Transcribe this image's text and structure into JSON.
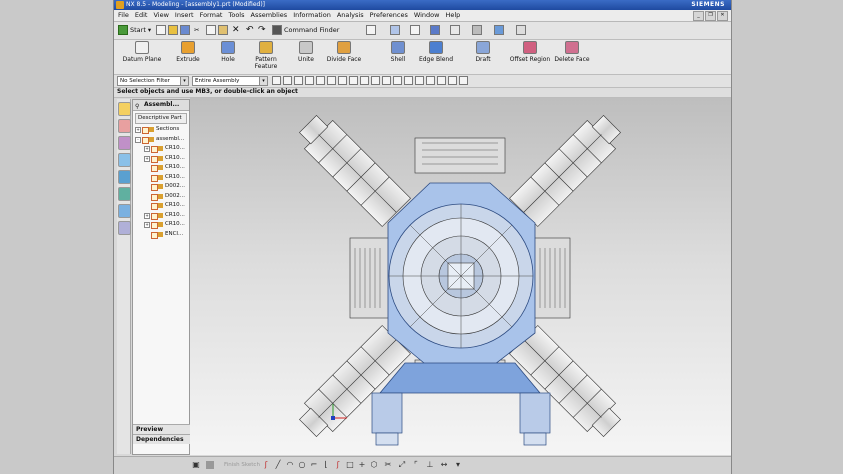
{
  "window": {
    "title": "NX 8.5 - Modeling - [assembly1.prt (Modified)]",
    "brand": "SIEMENS"
  },
  "menu": [
    "File",
    "Edit",
    "View",
    "Insert",
    "Format",
    "Tools",
    "Assemblies",
    "Information",
    "Analysis",
    "Preferences",
    "Window",
    "Help"
  ],
  "toolbar_top": {
    "start_label": "Start",
    "command_finder_label": "Command Finder"
  },
  "features": [
    {
      "label": "Datum Plane",
      "icon": "datum-plane-icon",
      "color": "#f0f0f0"
    },
    {
      "label": "Extrude",
      "icon": "extrude-icon",
      "color": "#e8a030"
    },
    {
      "label": "Hole",
      "icon": "hole-icon",
      "color": "#6b8fd6"
    },
    {
      "label": "Pattern Feature",
      "icon": "pattern-feature-icon",
      "color": "#e0b040"
    },
    {
      "label": "Unite",
      "icon": "unite-icon",
      "color": "#c8c8c8"
    },
    {
      "label": "Divide Face",
      "icon": "divide-face-icon",
      "color": "#e0a040"
    },
    {
      "label": "Shell",
      "icon": "shell-icon",
      "color": "#7090d0"
    },
    {
      "label": "Edge Blend",
      "icon": "edge-blend-icon",
      "color": "#4c7fd0"
    },
    {
      "label": "Draft",
      "icon": "draft-icon",
      "color": "#8aa6d8"
    },
    {
      "label": "Offset Region",
      "icon": "offset-region-icon",
      "color": "#d06080"
    },
    {
      "label": "Delete Face",
      "icon": "delete-face-icon",
      "color": "#d07090"
    }
  ],
  "selection_bar": {
    "filter": "No Selection Filter",
    "scope": "Entire Assembly"
  },
  "cue_line": "Select objects and use MB3, or double-click an object",
  "navigator": {
    "title": "Assembl...",
    "column_header": "Descriptive Part",
    "rows": [
      {
        "label": "Sections",
        "indent": 0,
        "expand": "+"
      },
      {
        "label": "assembl...",
        "indent": 0,
        "expand": "-"
      },
      {
        "label": "CR10...",
        "indent": 1,
        "expand": "+"
      },
      {
        "label": "CR10...",
        "indent": 1,
        "expand": "+"
      },
      {
        "label": "CR10...",
        "indent": 1,
        "expand": ""
      },
      {
        "label": "CR10...",
        "indent": 1,
        "expand": ""
      },
      {
        "label": "D002...",
        "indent": 1,
        "expand": ""
      },
      {
        "label": "D002...",
        "indent": 1,
        "expand": ""
      },
      {
        "label": "CR10...",
        "indent": 1,
        "expand": ""
      },
      {
        "label": "CR10...",
        "indent": 1,
        "expand": "+"
      },
      {
        "label": "CR10...",
        "indent": 1,
        "expand": "+"
      },
      {
        "label": "ENCI...",
        "indent": 1,
        "expand": ""
      }
    ],
    "preview_label": "Preview",
    "dependencies_label": "Dependencies"
  },
  "status_bar": {
    "sketch_label": "Finish Sketch"
  }
}
